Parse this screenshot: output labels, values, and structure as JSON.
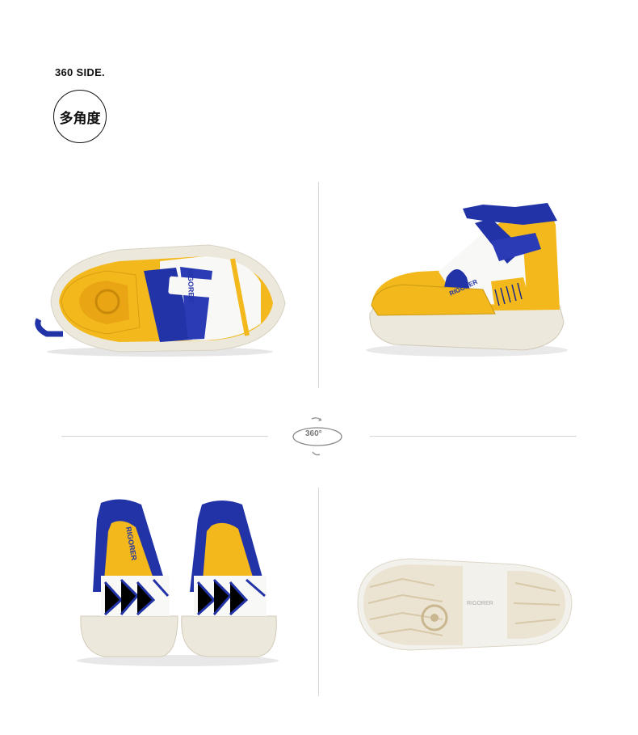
{
  "header": {
    "title": "360 SIDE.",
    "badge": "多角度"
  },
  "rotate_icon_label": "360°",
  "product_views": [
    {
      "name": "top-view",
      "brand_text": "RIGORER"
    },
    {
      "name": "side-view",
      "brand_text": "RIGORER"
    },
    {
      "name": "back-view",
      "brand_text": "RIGORER"
    },
    {
      "name": "sole-view",
      "brand_text": "RIGORER"
    }
  ],
  "colors": {
    "yellow": "#f2b81c",
    "blue": "#2233a8",
    "white": "#f6f6f4",
    "sole": "#efe9dc"
  }
}
